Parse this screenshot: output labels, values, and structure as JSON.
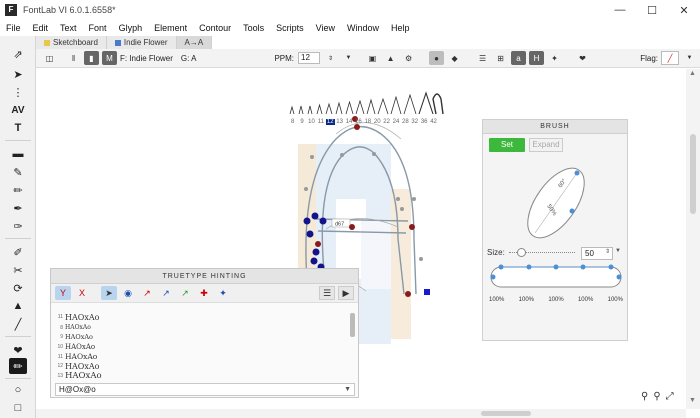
{
  "window": {
    "title": "FontLab VI 6.0.1.6558*",
    "app_icon": "F",
    "controls": [
      "minimize-icon",
      "maximize-icon",
      "close-icon"
    ]
  },
  "menu": [
    "File",
    "Edit",
    "Text",
    "Font",
    "Glyph",
    "Element",
    "Contour",
    "Tools",
    "Scripts",
    "View",
    "Window",
    "Help"
  ],
  "tabs": [
    {
      "label": "Sketchboard",
      "icon": "sketchboard-icon",
      "color": "#e8c84a"
    },
    {
      "label": "Indie Flower",
      "icon": "font-grid-icon",
      "color": "#4a7bc8"
    },
    {
      "label": "A→A",
      "icon": "glyph-tab-icon",
      "color": "#777777"
    }
  ],
  "toolstrip": {
    "font_label": "F: Indie Flower",
    "glyph_label": "G: A",
    "ppm_label": "PPM:",
    "ppm_value": "12",
    "flag_label": "Flag:"
  },
  "waterfall": {
    "sizes": [
      "8",
      "9",
      "10",
      "11",
      "12",
      "13",
      "14",
      "16",
      "18",
      "20",
      "22",
      "24",
      "28",
      "32",
      "36",
      "42"
    ],
    "highlight": "12"
  },
  "brush_panel": {
    "title": "BRUSH",
    "set_label": "Set",
    "expand_label": "Expand",
    "size_label": "Size:",
    "size_value": "50",
    "angle_label": "60°",
    "ratio_label": "50%",
    "percentages": [
      "100%",
      "100%",
      "100%",
      "100%",
      "100%"
    ],
    "accent_color": "#3cb93c"
  },
  "hinting_panel": {
    "title": "TRUETYPE HINTING",
    "rows": [
      {
        "size": "11",
        "text": "HAOxAo"
      },
      {
        "size": "8",
        "text": "HAOxAo"
      },
      {
        "size": "9",
        "text": "HAOxAo"
      },
      {
        "size": "10",
        "text": "HAOxAo"
      },
      {
        "size": "11",
        "text": "HAOxAo"
      },
      {
        "size": "12",
        "text": "HAOxAo"
      },
      {
        "size": "13",
        "text": "HAOxAo"
      }
    ],
    "input_value": "H@Ox@o"
  },
  "canvas": {
    "measure_label": "d67"
  }
}
